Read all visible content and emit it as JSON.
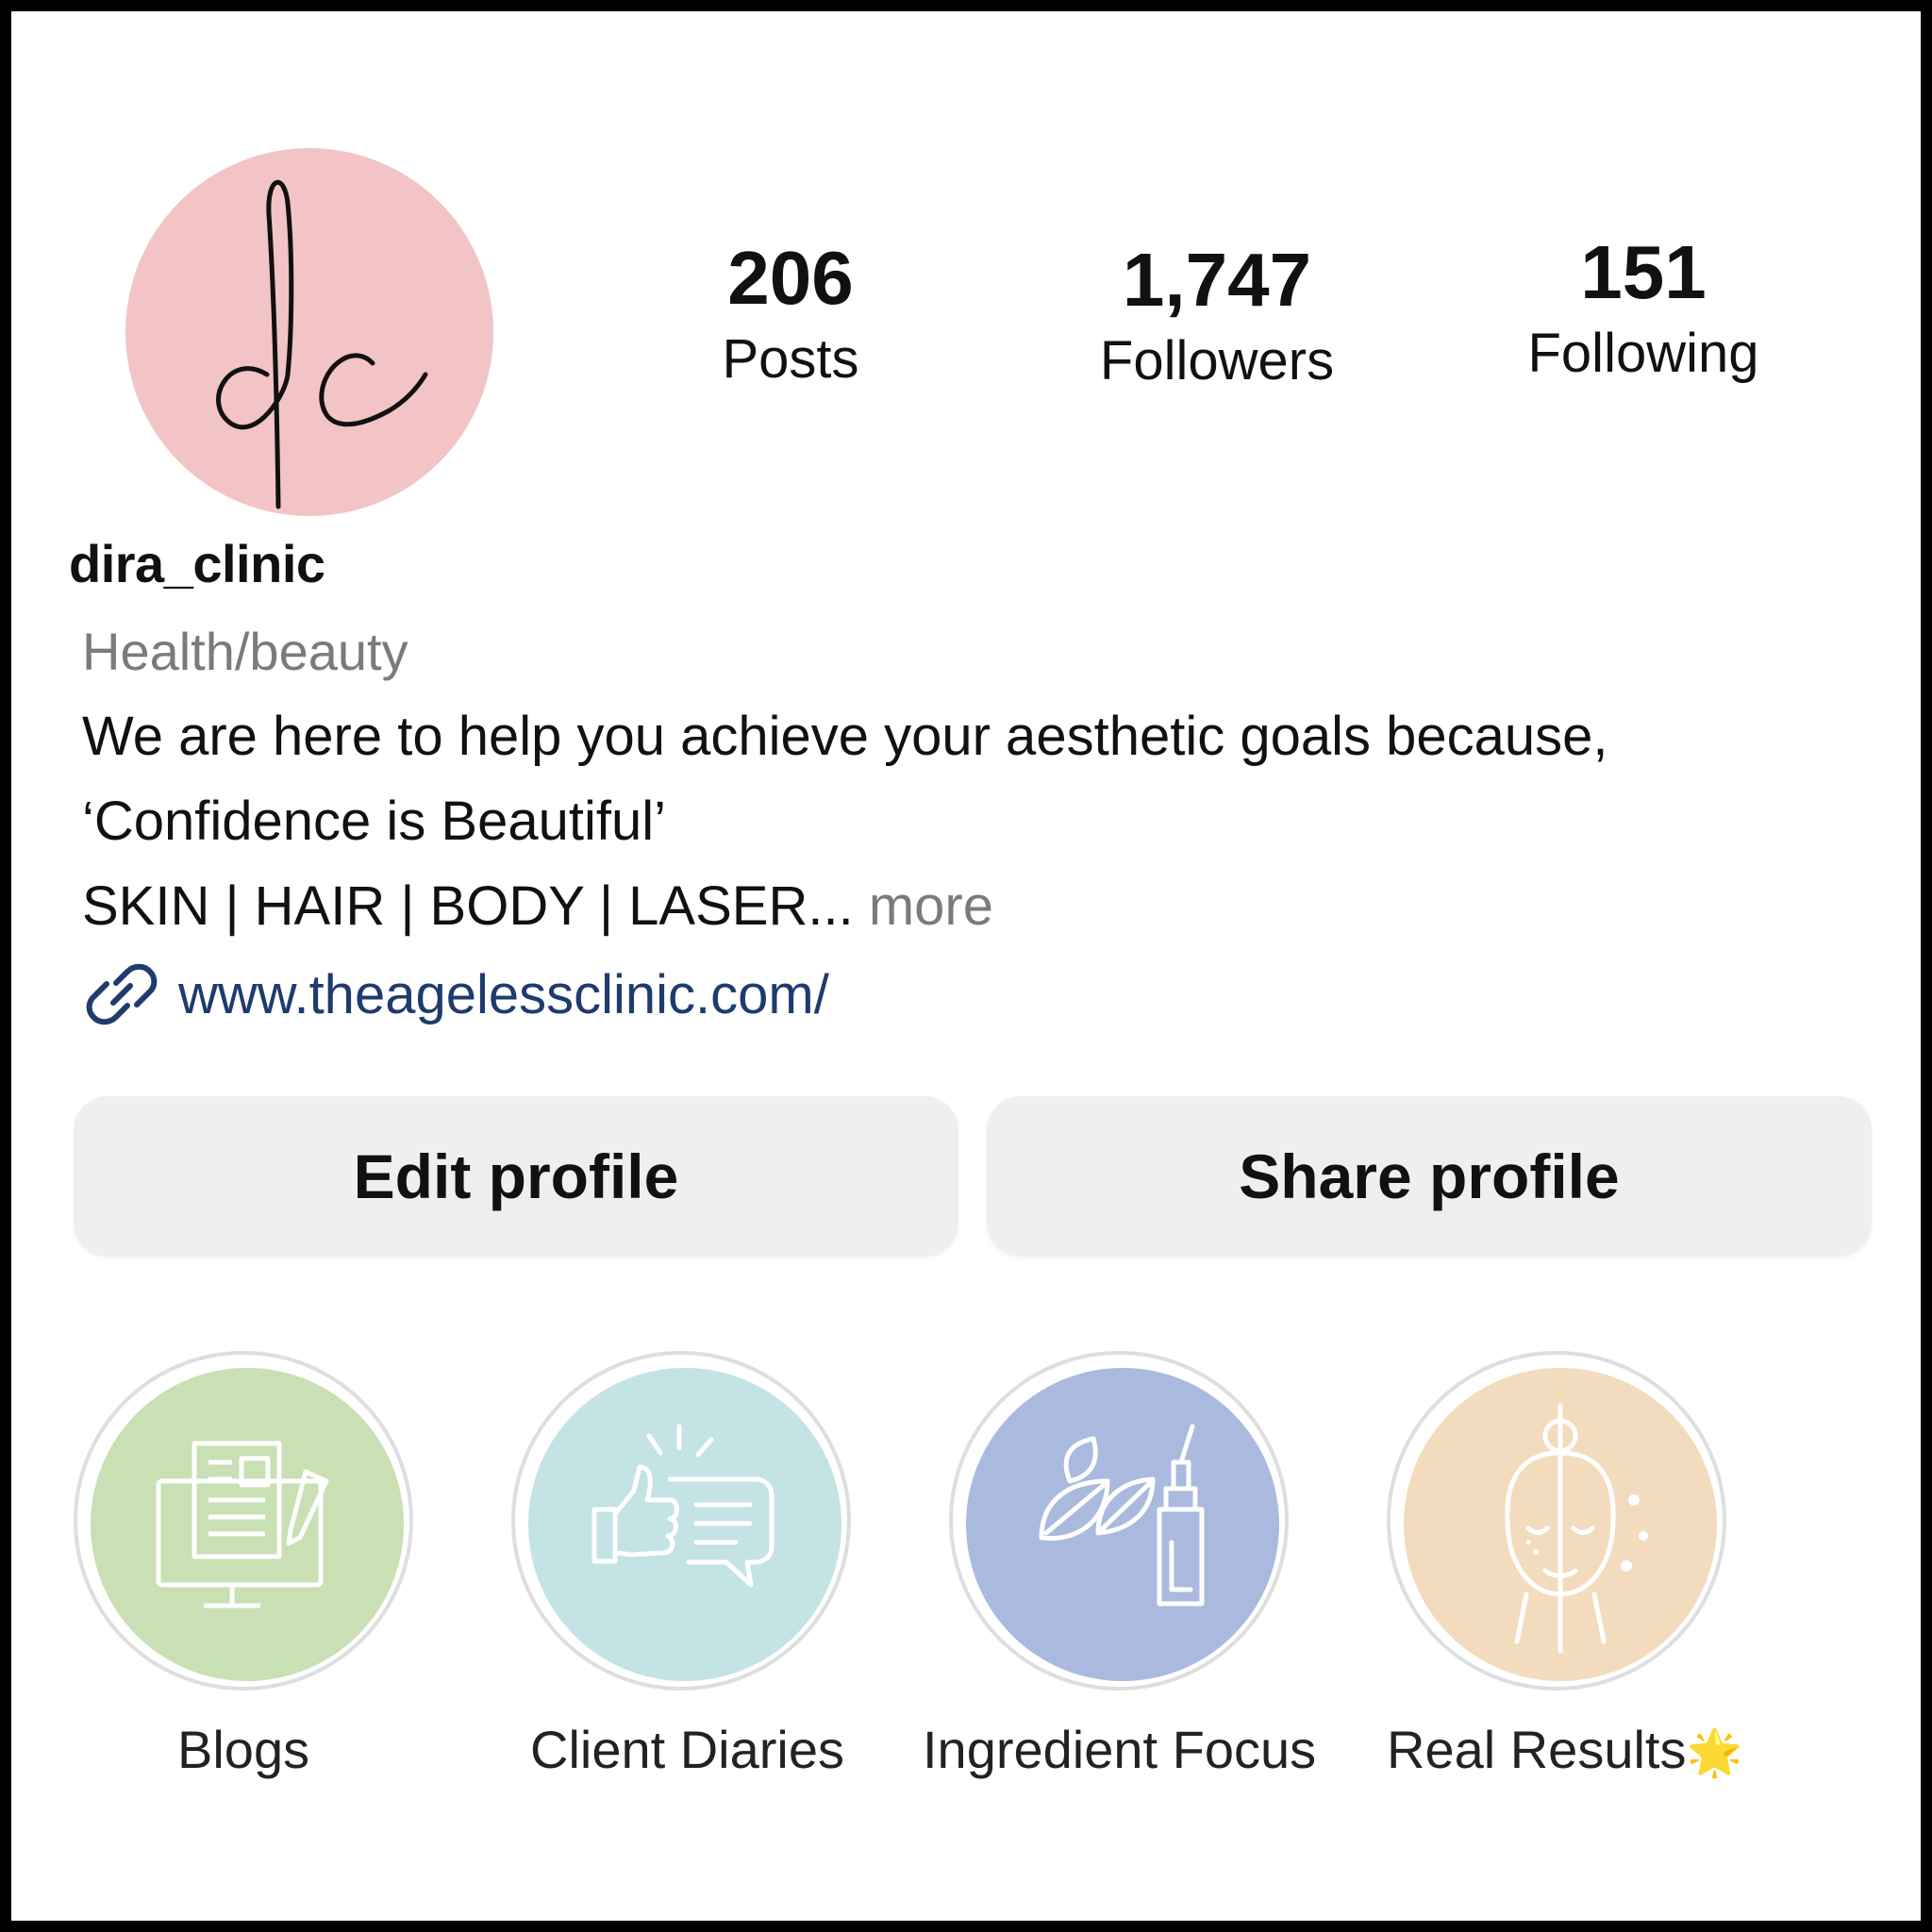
{
  "profile": {
    "username": "dira_clinic",
    "category": "Health/beauty",
    "bio_line1": "We are here to help you achieve your aesthetic goals because,",
    "bio_line2": "‘Confidence is Beautiful’",
    "bio_line3": "SKIN | HAIR | BODY | LASER...",
    "more_label": " more",
    "website": "www.theagelessclinic.com/",
    "avatar_monogram": "dc",
    "avatar_color": "#f2c4c6"
  },
  "stats": {
    "posts_count": "206",
    "posts_label": "Posts",
    "followers_count": "1,747",
    "followers_label": "Followers",
    "following_count": "151",
    "following_label": "Following"
  },
  "buttons": {
    "edit_label": "Edit profile",
    "share_label": "Share profile"
  },
  "highlights": [
    {
      "label": "Blogs",
      "color": "#c9dfb4",
      "icon": "blog-computer-icon"
    },
    {
      "label": "Client Diaries",
      "color": "#c3e3e4",
      "icon": "thumbs-up-chat-icon"
    },
    {
      "label": "Ingredient Focus",
      "color": "#aab9de",
      "icon": "leaf-serum-icon"
    },
    {
      "label": "Real Results",
      "color": "#f2dcbd",
      "icon": "face-icon",
      "emoji": "🌟"
    }
  ]
}
